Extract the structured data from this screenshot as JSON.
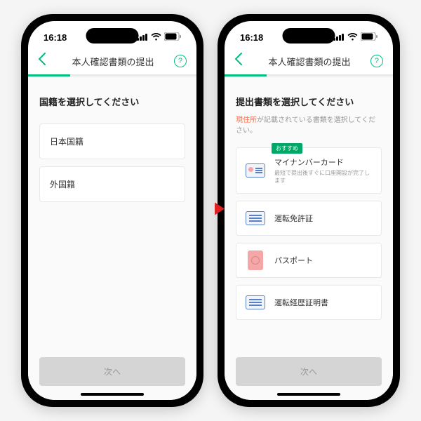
{
  "status": {
    "time": "16:18"
  },
  "nav": {
    "title": "本人確認書類の提出",
    "help": "?"
  },
  "screen1": {
    "title": "国籍を選択してください",
    "options": [
      "日本国籍",
      "外国籍"
    ],
    "progress_width": "25%"
  },
  "screen2": {
    "title": "提出書類を選択してください",
    "subtitle_highlight": "現住所",
    "subtitle_rest": "が記載されている書類を選択してください。",
    "badge": "おすすめ",
    "docs": [
      {
        "title": "マイナンバーカード",
        "desc": "最短で提出後すぐに口座開設が完了します"
      },
      {
        "title": "運転免許証"
      },
      {
        "title": "パスポート"
      },
      {
        "title": "運転経歴証明書"
      }
    ],
    "progress_width": "25%"
  },
  "buttons": {
    "next": "次へ"
  }
}
